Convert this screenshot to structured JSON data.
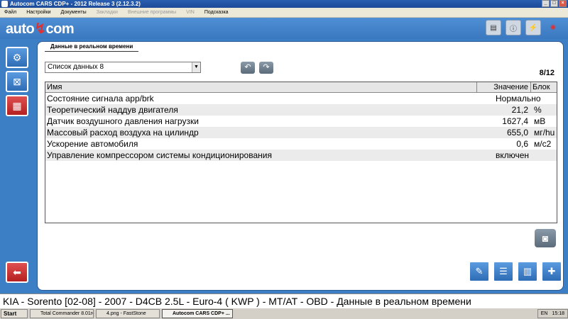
{
  "window": {
    "title": "Autocom CARS CDP+ - 2012 Release 3 (2.12.3.2)",
    "controls": [
      "_",
      "□",
      "×"
    ]
  },
  "menu": [
    "Файл",
    "Настройки",
    "Документы",
    "Закладки",
    "Внешние программы",
    "VIN",
    "Подсказка"
  ],
  "logo": {
    "part1": "auto",
    "part2": "com"
  },
  "tab_title": "Данные в реальном времени",
  "select_value": "Список данных 8",
  "page_count": "8/12",
  "table": {
    "headers": {
      "name": "Имя",
      "value": "Значение",
      "block": "Блок"
    },
    "rows": [
      {
        "name": "Состояние сигнала app/brk",
        "value": "Нормально",
        "unit": ""
      },
      {
        "name": "Теоретический наддув двигателя",
        "value": "21,2",
        "unit": "%"
      },
      {
        "name": "Датчик воздушного давления нагрузки",
        "value": "1627,4",
        "unit": "мВ"
      },
      {
        "name": "Массовый расход воздуха на цилиндр",
        "value": "655,0",
        "unit": "мг/hu"
      },
      {
        "name": "Ускорение автомобиля",
        "value": "0,6",
        "unit": "м/с2"
      },
      {
        "name": "Управление компрессором системы кондиционирования",
        "value": "включен",
        "unit": ""
      }
    ]
  },
  "status": "KIA - Sorento [02-08] - 2007 - D4CB 2.5L - Euro-4 ( KWP ) - MT/AT - OBD - Данные в реальном времени",
  "taskbar": {
    "start": "Start",
    "tasks": [
      "Total Commander 8.01rc...",
      "4.png - FastStone",
      "Autocom CARS CDP+ ..."
    ],
    "tray": {
      "lang": "EN",
      "time": "15:18"
    }
  },
  "icons": {
    "sidebar": [
      "engine-icon",
      "brake-icon",
      "gauge-icon"
    ],
    "back": "back-arrow-icon",
    "header": [
      "obd-icon",
      "info-icon",
      "flash-icon",
      "loading-icon"
    ],
    "bottom": [
      "report-icon",
      "list-icon",
      "graph-icon",
      "diagnostic-icon"
    ]
  }
}
